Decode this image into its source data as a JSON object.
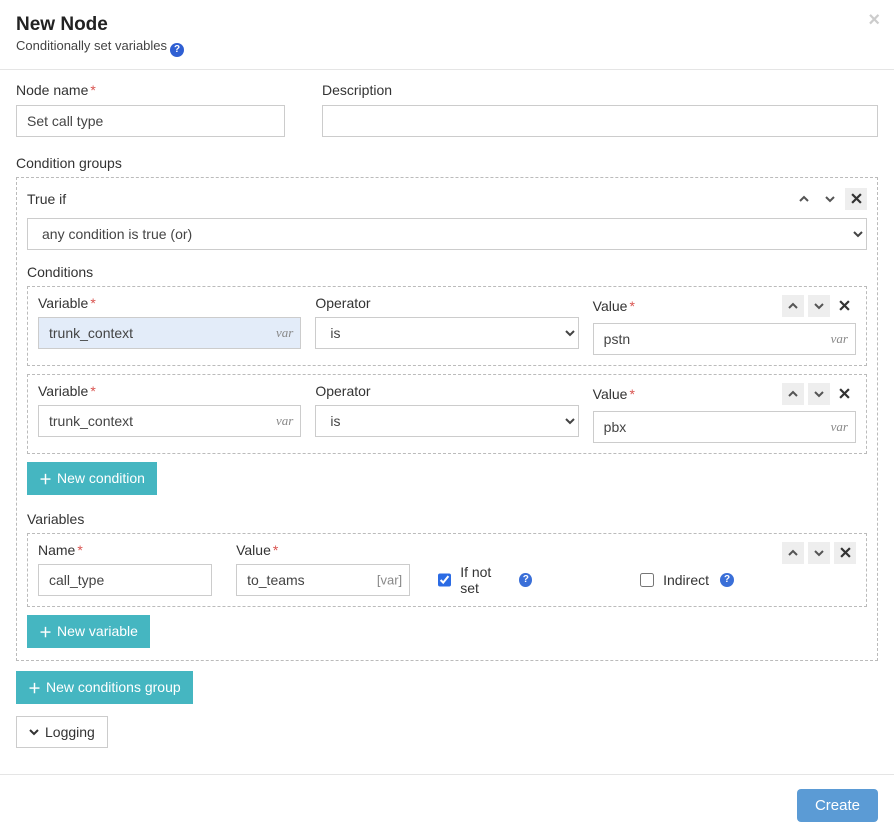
{
  "header": {
    "title": "New Node",
    "subtitle": "Conditionally set variables"
  },
  "form": {
    "node_name_label": "Node name",
    "node_name_value": "Set call type",
    "description_label": "Description",
    "description_value": ""
  },
  "condition_groups_label": "Condition groups",
  "group": {
    "true_if_label": "True if",
    "logic_select_value": "any condition is true (or)",
    "conditions_label": "Conditions",
    "conditions": [
      {
        "variable_label": "Variable",
        "variable_value": "trunk_context",
        "variable_suffix": "var",
        "operator_label": "Operator",
        "operator_value": "is",
        "value_label": "Value",
        "value_value": "pstn",
        "value_suffix": "var",
        "highlighted": true
      },
      {
        "variable_label": "Variable",
        "variable_value": "trunk_context",
        "variable_suffix": "var",
        "operator_label": "Operator",
        "operator_value": "is",
        "value_label": "Value",
        "value_value": "pbx",
        "value_suffix": "var",
        "highlighted": false
      }
    ],
    "new_condition_label": "New condition",
    "variables_label": "Variables",
    "variable_row": {
      "name_label": "Name",
      "name_value": "call_type",
      "value_label": "Value",
      "value_value": "to_teams",
      "value_suffix": "[var]",
      "if_not_set_label": "If not set",
      "if_not_set_checked": true,
      "indirect_label": "Indirect",
      "indirect_checked": false
    },
    "new_variable_label": "New variable"
  },
  "new_conditions_group_label": "New conditions group",
  "logging_label": "Logging",
  "footer": {
    "create_label": "Create"
  }
}
